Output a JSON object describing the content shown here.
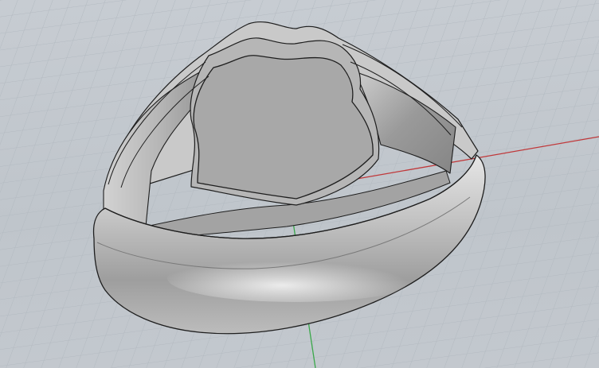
{
  "viewport": {
    "projection": "perspective",
    "grid": true,
    "axes": [
      "x-axis",
      "y-axis"
    ],
    "colors": {
      "background": "#c3c9cf",
      "grid_minor": "#b3bac1",
      "grid_major": "#a9b1b8",
      "x_axis": "#c0383a",
      "y_axis": "#3aa84a",
      "model_metal": "#b9b9b9",
      "model_face": "#a7a7a7",
      "edge_lines": "#1e1e1e"
    }
  },
  "model": {
    "object": "signet-ring",
    "display_mode": "shaded-with-edges"
  }
}
